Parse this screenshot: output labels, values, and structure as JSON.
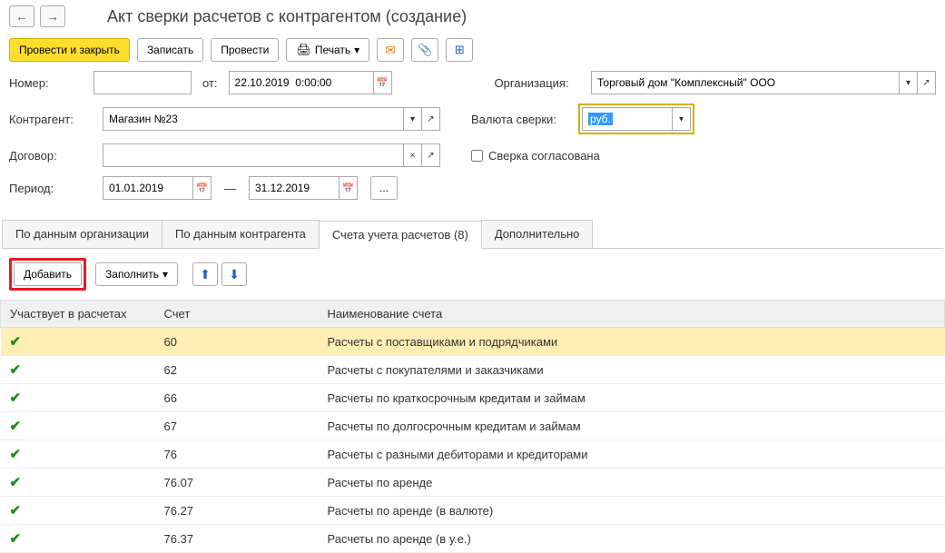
{
  "nav": {
    "back": "←",
    "fwd": "→"
  },
  "title": "Акт сверки расчетов с контрагентом (создание)",
  "toolbar": {
    "post_close": "Провести и закрыть",
    "write": "Записать",
    "post": "Провести",
    "print": "Печать"
  },
  "form": {
    "number_label": "Номер:",
    "number_value": "",
    "from_label": "от:",
    "date_value": "22.10.2019  0:00:00",
    "org_label": "Организация:",
    "org_value": "Торговый дом \"Комплексный\" ООО",
    "contractor_label": "Контрагент:",
    "contractor_value": "Магазин №23",
    "currency_label": "Валюта сверки:",
    "currency_value": "руб.",
    "contract_label": "Договор:",
    "contract_value": "",
    "agreed_label": "Сверка согласована",
    "period_label": "Период:",
    "period_from": "01.01.2019",
    "period_sep": "—",
    "period_to": "31.12.2019"
  },
  "tabs": {
    "t1": "По данным организации",
    "t2": "По данным контрагента",
    "t3": "Счета учета расчетов (8)",
    "t4": "Дополнительно"
  },
  "tab_toolbar": {
    "add": "Добавить",
    "fill": "Заполнить"
  },
  "table": {
    "h1": "Участвует в расчетах",
    "h2": "Счет",
    "h3": "Наименование счета",
    "rows": [
      {
        "acct": "60",
        "name": "Расчеты с поставщиками и подрядчиками"
      },
      {
        "acct": "62",
        "name": "Расчеты с покупателями и заказчиками"
      },
      {
        "acct": "66",
        "name": "Расчеты по краткосрочным кредитам и займам"
      },
      {
        "acct": "67",
        "name": "Расчеты по долгосрочным кредитам и займам"
      },
      {
        "acct": "76",
        "name": "Расчеты с разными дебиторами и кредиторами"
      },
      {
        "acct": "76.07",
        "name": "Расчеты по аренде"
      },
      {
        "acct": "76.27",
        "name": "Расчеты по аренде (в валюте)"
      },
      {
        "acct": "76.37",
        "name": "Расчеты по аренде (в у.е.)"
      }
    ]
  }
}
